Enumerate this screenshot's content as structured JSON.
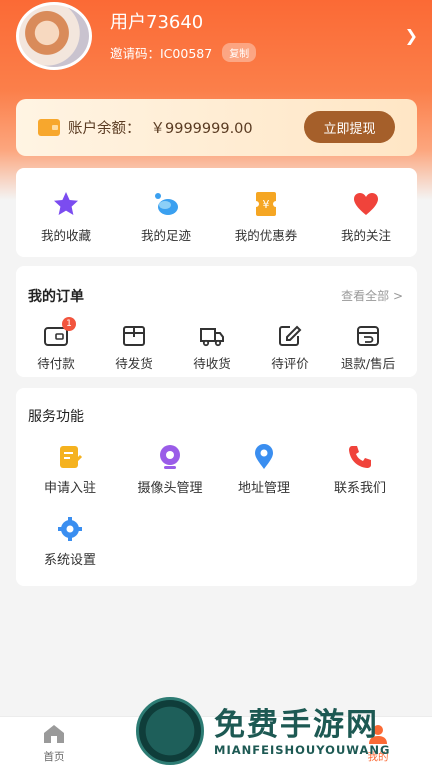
{
  "profile": {
    "username": "用户73640",
    "invite_label": "邀请码：IC00587",
    "copy_label": "复制"
  },
  "wallet": {
    "label": "账户余额：",
    "amount": "￥9999999.00",
    "withdraw_label": "立即提现"
  },
  "quick_links": [
    {
      "label": "我的收藏",
      "icon": "star-icon",
      "color": "#7b4cf0"
    },
    {
      "label": "我的足迹",
      "icon": "footprint-icon",
      "color": "#3aa0f0"
    },
    {
      "label": "我的优惠券",
      "icon": "coupon-icon",
      "color": "#f5a623"
    },
    {
      "label": "我的关注",
      "icon": "heart-icon",
      "color": "#f0433b"
    }
  ],
  "orders": {
    "title": "我的订单",
    "view_all": "查看全部 >",
    "items": [
      {
        "label": "待付款",
        "icon": "wallet-icon",
        "badge": "1"
      },
      {
        "label": "待发货",
        "icon": "package-icon"
      },
      {
        "label": "待收货",
        "icon": "truck-icon"
      },
      {
        "label": "待评价",
        "icon": "edit-icon"
      },
      {
        "label": "退款/售后",
        "icon": "refund-icon"
      }
    ]
  },
  "services": {
    "title": "服务功能",
    "items": [
      {
        "label": "申请入驻",
        "icon": "apply-icon",
        "color": "#f5b21f"
      },
      {
        "label": "摄像头管理",
        "icon": "camera-icon",
        "color": "#9a5ce8"
      },
      {
        "label": "地址管理",
        "icon": "location-icon",
        "color": "#3a8ef0"
      },
      {
        "label": "联系我们",
        "icon": "phone-icon",
        "color": "#f0433b"
      },
      {
        "label": "系统设置",
        "icon": "settings-icon",
        "color": "#3a8ef0"
      }
    ]
  },
  "tabbar": {
    "items": [
      {
        "label": "首页",
        "icon": "home-icon"
      },
      {
        "label": "我的",
        "icon": "profile-icon"
      }
    ]
  },
  "watermark": {
    "title": "免费手游网",
    "subtitle": "MIANFEISHOUYOUWANG"
  },
  "colors": {
    "accent": "#fb6a35",
    "withdraw": "#a55f2a",
    "badge": "#f2543d"
  }
}
